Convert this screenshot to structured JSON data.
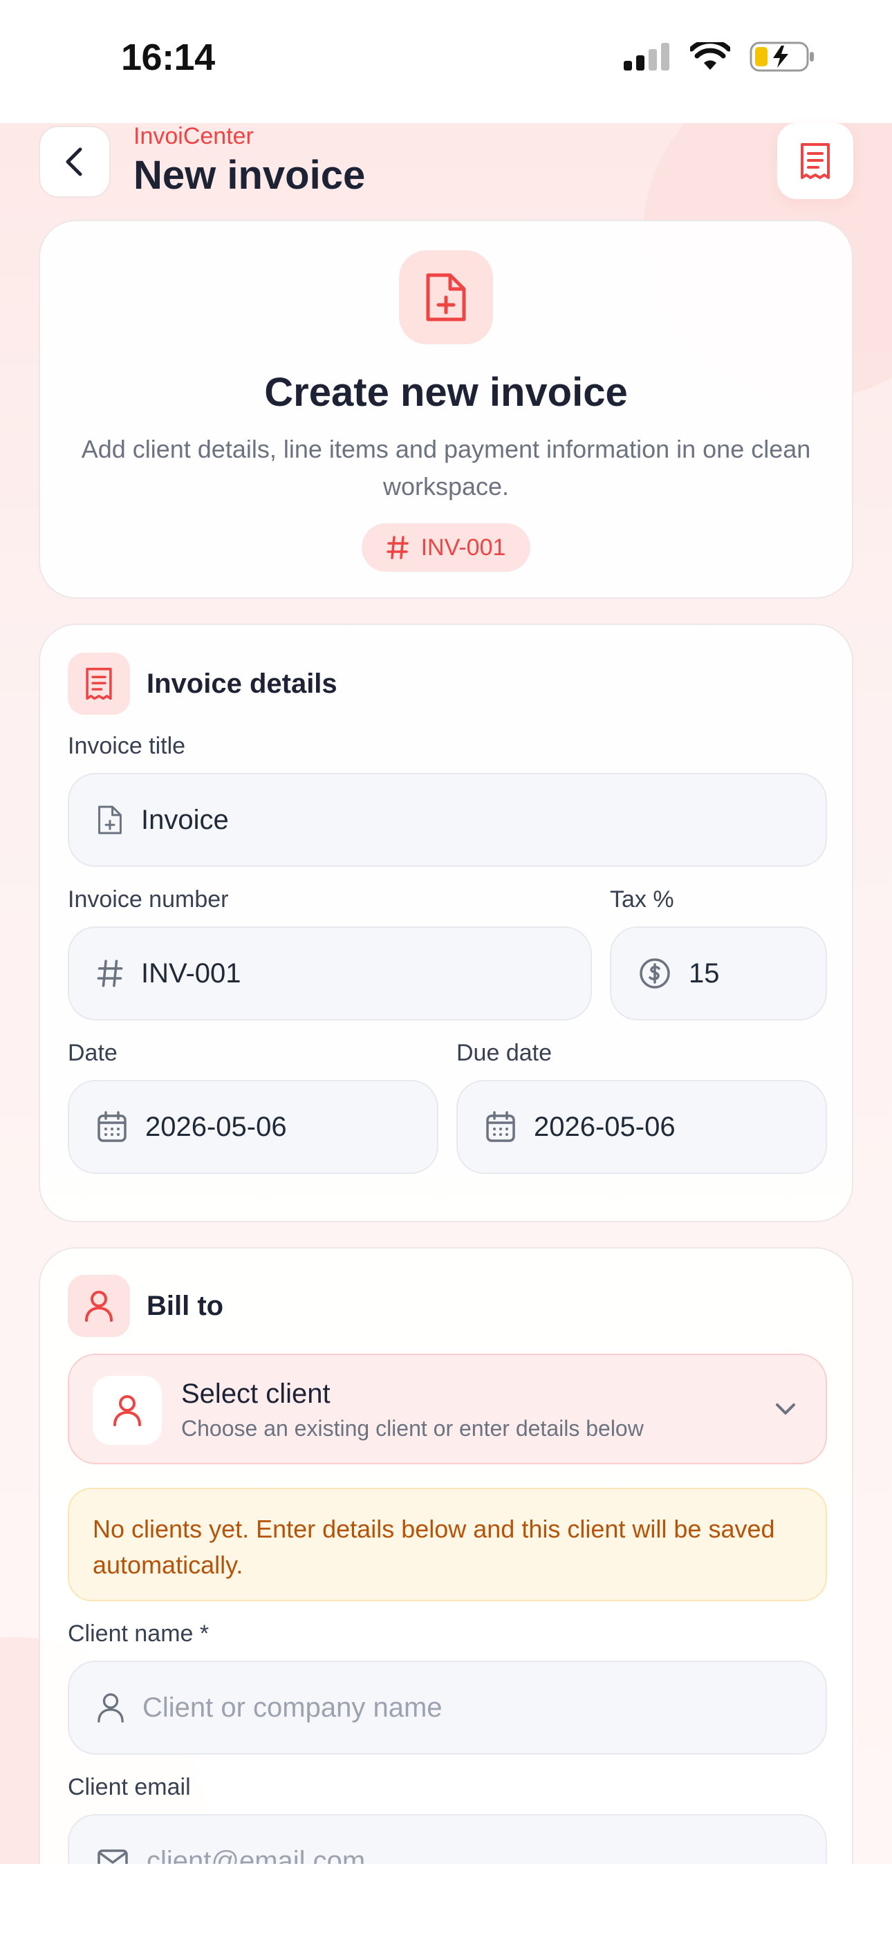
{
  "status_bar": {
    "time": "16:14"
  },
  "header": {
    "brand": "InvoiCenter",
    "title": "New invoice"
  },
  "hero": {
    "title": "Create new invoice",
    "subtitle": "Add client details, line items and payment information in one clean workspace.",
    "badge": "INV-001"
  },
  "invoice_details": {
    "section_title": "Invoice details",
    "title_label": "Invoice title",
    "title_value": "Invoice",
    "number_label": "Invoice number",
    "number_value": "INV-001",
    "tax_label": "Tax %",
    "tax_value": "15",
    "date_label": "Date",
    "date_value": "2026-05-06",
    "due_label": "Due date",
    "due_value": "2026-05-06"
  },
  "bill_to": {
    "section_title": "Bill to",
    "select_title": "Select client",
    "select_subtitle": "Choose an existing client or enter details below",
    "notice": "No clients yet. Enter details below and this client will be saved automatically.",
    "name_label": "Client name *",
    "name_placeholder": "Client or company name",
    "email_label": "Client email",
    "email_placeholder": "client@email.com"
  },
  "colors": {
    "accent": "#ef4444",
    "title": "#1e2235",
    "notice_text": "#b45309"
  }
}
